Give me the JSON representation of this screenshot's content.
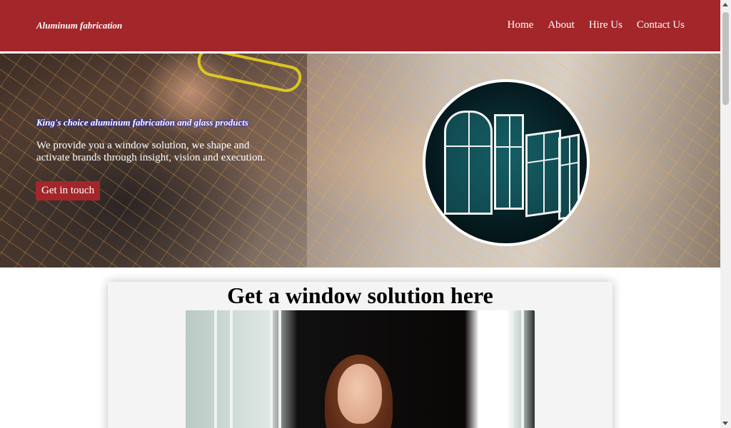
{
  "header": {
    "brand": "Aluminum fabrication",
    "nav": [
      {
        "label": "Home"
      },
      {
        "label": "About"
      },
      {
        "label": "Hire Us"
      },
      {
        "label": "Contact Us"
      }
    ]
  },
  "hero": {
    "tagline": "King's choice aluminum fabrication and glass products",
    "description": "We provide you a window solution, we shape and activate brands through insight, vision and execution.",
    "cta_label": "Get in touch"
  },
  "section": {
    "title": "Get a window solution here"
  },
  "colors": {
    "brand": "#a3272a",
    "text_light": "#ffffff"
  }
}
